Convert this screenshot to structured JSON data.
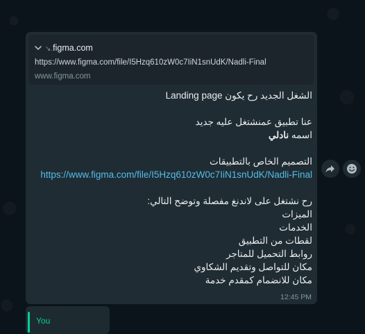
{
  "message": {
    "link_preview": {
      "domain": "figma.com",
      "domain_prefix": "↘.",
      "url": "https://www.figma.com/file/I5Hzq610zW0c7IiN1snUdK/Nadli-Final",
      "site": "www.figma.com"
    },
    "lines": {
      "l1_ar": "الشغل الجديد رح يكون",
      "l1_en": "Landing page",
      "l2": "عنا تطبيق عمنشتغل عليه جديد",
      "l3_pre": "اسمه",
      "l3_bold": "نادلي",
      "l4": "التصميم الخاص بالتطبيقات",
      "l5_link": "https://www.figma.com/file/I5Hzq610zW0c7IiN1snUdK/Nadli-Final",
      "l6": "رح نشتغل على لاندنغ مفصلة وتوضح التالي:",
      "l7": "الميزات",
      "l8": "الخدمات",
      "l9": "لقطات من التطبيق",
      "l10": "روابط التحميل للمتاجر",
      "l11": "مكان للتواصل وتقديم الشكاوي",
      "l12": "مكان للانضمام كمقدم خدمة"
    },
    "time": "12:45 PM"
  },
  "actions": {
    "forward_icon": "forward-icon",
    "emoji_icon": "emoji-icon"
  },
  "reply": {
    "name": "You"
  },
  "colors": {
    "background": "#0b141a",
    "bubble": "#202c33",
    "link": "#53bdeb",
    "reply_accent": "#06cf9c"
  }
}
